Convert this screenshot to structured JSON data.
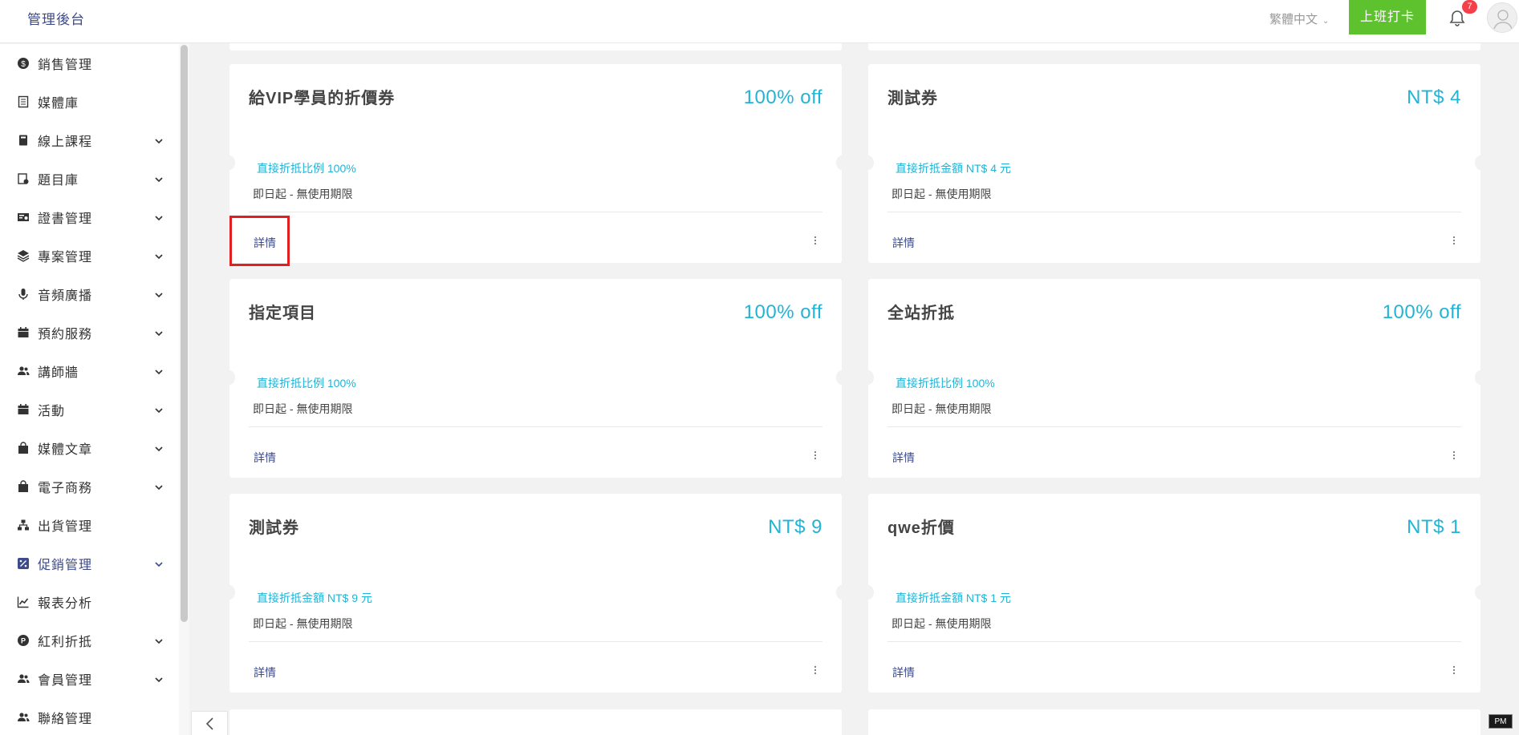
{
  "header": {
    "brand": "管理後台",
    "language": "繁體中文",
    "clock_in_label": "上班打卡",
    "notification_count": "7"
  },
  "sidebar": {
    "items": [
      {
        "label": "銷售管理",
        "icon": "dollar-icon",
        "expandable": false
      },
      {
        "label": "媒體庫",
        "icon": "media-library-icon",
        "expandable": false
      },
      {
        "label": "線上課程",
        "icon": "book-icon",
        "expandable": true
      },
      {
        "label": "題目庫",
        "icon": "question-bank-icon",
        "expandable": true
      },
      {
        "label": "證書管理",
        "icon": "certificate-icon",
        "expandable": true
      },
      {
        "label": "專案管理",
        "icon": "layers-icon",
        "expandable": true
      },
      {
        "label": "音頻廣播",
        "icon": "microphone-icon",
        "expandable": true
      },
      {
        "label": "預約服務",
        "icon": "calendar-icon",
        "expandable": true
      },
      {
        "label": "講師牆",
        "icon": "users-icon",
        "expandable": true
      },
      {
        "label": "活動",
        "icon": "calendar-icon",
        "expandable": true
      },
      {
        "label": "媒體文章",
        "icon": "bag-icon",
        "expandable": true
      },
      {
        "label": "電子商務",
        "icon": "bag-icon",
        "expandable": true
      },
      {
        "label": "出貨管理",
        "icon": "sitemap-icon",
        "expandable": false
      },
      {
        "label": "促銷管理",
        "icon": "percent-icon",
        "expandable": true,
        "active": true
      },
      {
        "label": "報表分析",
        "icon": "chart-icon",
        "expandable": false
      },
      {
        "label": "紅利折抵",
        "icon": "points-icon",
        "expandable": true
      },
      {
        "label": "會員管理",
        "icon": "users-icon",
        "expandable": true
      },
      {
        "label": "聯絡管理",
        "icon": "users-icon",
        "expandable": false
      }
    ]
  },
  "coupons": [
    {
      "title": "給VIP學員的折價券",
      "value": "100% off",
      "discount": "直接折抵比例 100%",
      "period": "即日起 - 無使用期限",
      "details": "詳情"
    },
    {
      "title": "測試券",
      "value": "NT$ 4",
      "discount": "直接折抵金額 NT$ 4 元",
      "period": "即日起 - 無使用期限",
      "details": "詳情"
    },
    {
      "title": "指定項目",
      "value": "100% off",
      "discount": "直接折抵比例 100%",
      "period": "即日起 - 無使用期限",
      "details": "詳情"
    },
    {
      "title": "全站折抵",
      "value": "100% off",
      "discount": "直接折抵比例 100%",
      "period": "即日起 - 無使用期限",
      "details": "詳情"
    },
    {
      "title": "測試券",
      "value": "NT$ 9",
      "discount": "直接折抵金額 NT$ 9 元",
      "period": "即日起 - 無使用期限",
      "details": "詳情"
    },
    {
      "title": "qwe折價",
      "value": "NT$ 1",
      "discount": "直接折抵金額 NT$ 1 元",
      "period": "即日起 - 無使用期限",
      "details": "詳情"
    }
  ],
  "overlay": {
    "pm_label": "PM"
  },
  "colors": {
    "accent": "#22b4d6",
    "brand": "#3d4a8c",
    "clock_button": "#5ec22f",
    "badge": "#f5404a",
    "highlight": "#e02020"
  }
}
